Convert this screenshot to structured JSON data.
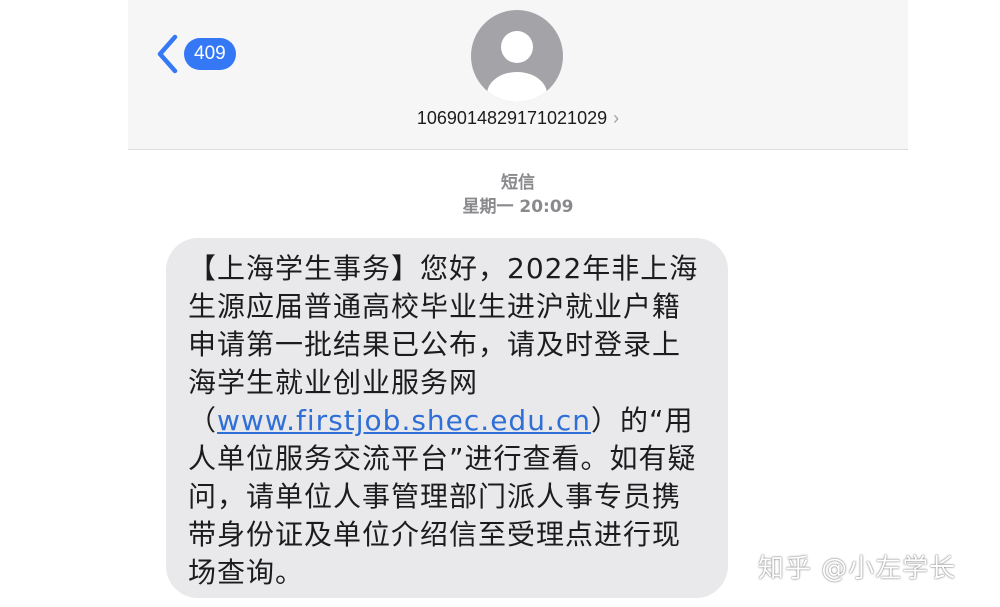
{
  "header": {
    "back_badge": "409",
    "sender_number": "1069014829171021029",
    "sender_chevron": "›"
  },
  "thread": {
    "channel_label": "短信",
    "timestamp": "星期一 20:09"
  },
  "message": {
    "text_before_link": "【上海学生事务】您好，2022年非上海生源应届普通高校毕业生进沪就业户籍申请第一批结果已公布，请及时登录上海学生就业创业服务网（",
    "link": "www.firstjob.shec.edu.cn",
    "text_after_link": "）的“用人单位服务交流平台”进行查看。如有疑问，请单位人事管理部门派人事专员携带身份证及单位介绍信至受理点进行现场查询。"
  },
  "watermark": "知乎 @小左学长",
  "colors": {
    "accent": "#3478f6",
    "bubble": "#e9e9eb",
    "link": "#2f6fd6",
    "header_bg": "#f6f6f6"
  },
  "icons": {
    "back": "chevron-left-icon",
    "avatar": "person-silhouette-icon",
    "sender_details": "chevron-right-icon"
  }
}
